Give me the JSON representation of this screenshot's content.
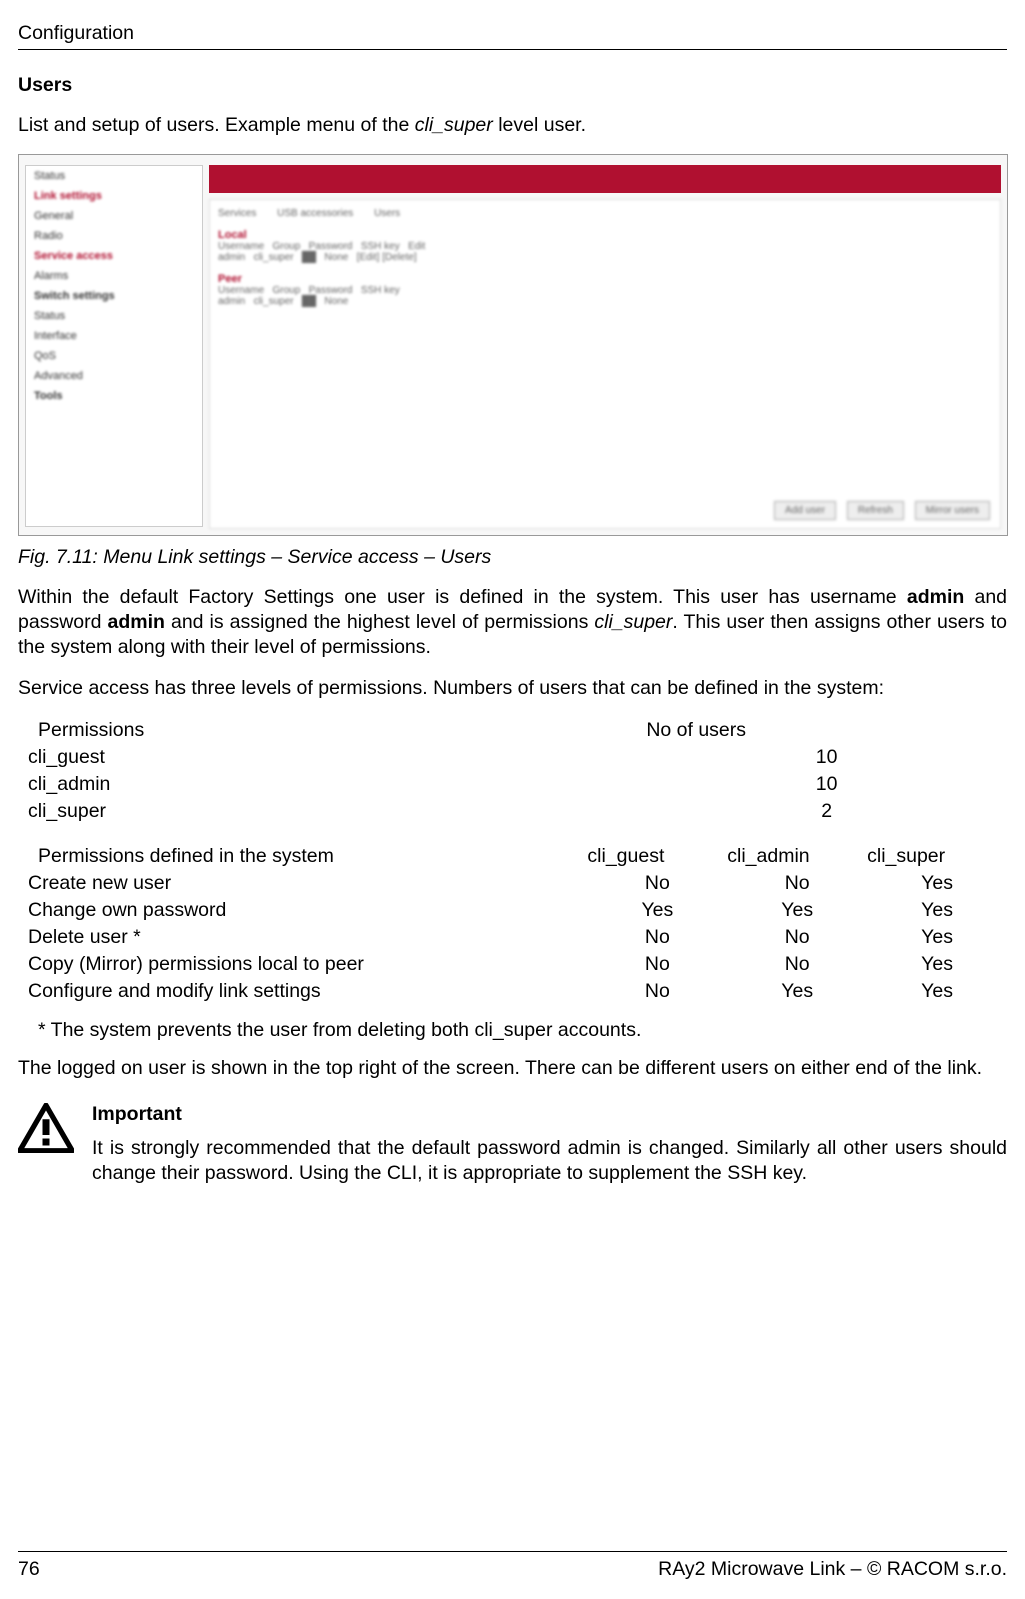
{
  "header": {
    "running": "Configuration"
  },
  "section": {
    "title": "Users",
    "intro_a": "List and setup of users. Example menu of the ",
    "intro_em": "cli_super",
    "intro_b": " level user."
  },
  "figure": {
    "caption": "Fig. 7.11: Menu Link settings – Service access – Users",
    "sidebar": [
      "Status",
      "Link settings",
      "General",
      "Radio",
      "Service access",
      "Alarms",
      "Switch settings",
      "Status",
      "Interface",
      "QoS",
      "Advanced",
      "Tools"
    ],
    "tabs": [
      "Services",
      "USB accessories",
      "Users"
    ],
    "group1": "Local",
    "group2": "Peer",
    "buttons": [
      "Add user",
      "Refresh",
      "Mirror users"
    ]
  },
  "body": {
    "p1a": "Within the default Factory Settings one user is defined in the system. This user has username ",
    "p1b": "admin",
    "p1c": " and password ",
    "p1d": "admin",
    "p1e": " and is assigned the highest level of permissions ",
    "p1em": "cli_super",
    "p1f": ". This user then assigns other users to the system along with their level of permissions.",
    "p2": "Service access has three levels of permissions. Numbers of users that can be defined in the system:"
  },
  "table1": {
    "headers": [
      "Permissions",
      "No of users"
    ],
    "rows": [
      {
        "perm": "cli_guest",
        "num": "10"
      },
      {
        "perm": "cli_admin",
        "num": "10"
      },
      {
        "perm": "cli_super",
        "num": "2"
      }
    ]
  },
  "table2": {
    "headers": [
      "Permissions defined in the system",
      "cli_guest",
      "cli_admin",
      "cli_super"
    ],
    "rows": [
      {
        "label": "Create new user",
        "g": "No",
        "a": "No",
        "s": "Yes"
      },
      {
        "label": "Change own password",
        "g": "Yes",
        "a": "Yes",
        "s": "Yes"
      },
      {
        "label": "Delete user *",
        "g": "No",
        "a": "No",
        "s": "Yes"
      },
      {
        "label": "Copy (Mirror) permissions local to peer",
        "g": "No",
        "a": "No",
        "s": "Yes"
      },
      {
        "label": "Configure and modify link settings",
        "g": "No",
        "a": "Yes",
        "s": "Yes"
      }
    ]
  },
  "footnote": "* The system prevents the user from deleting both cli_super accounts.",
  "body2": {
    "p3": "The logged on user is shown in the top right of the screen. There can be different users on either end of the link."
  },
  "important": {
    "title": "Important",
    "body": "It is strongly recommended that the default password admin is changed. Similarly all other users should change their password. Using the CLI, it is appropriate to supplement the SSH key."
  },
  "footer": {
    "page": "76",
    "right": "RAy2 Microwave Link – © RACOM s.r.o."
  }
}
